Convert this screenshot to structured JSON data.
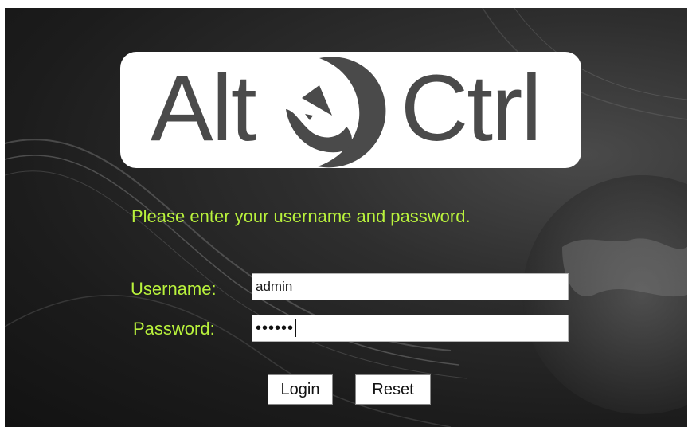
{
  "logo": {
    "left_text": "Alt",
    "right_text": "Ctrl"
  },
  "login": {
    "prompt": "Please enter your username and password.",
    "username_label": "Username:",
    "username_value": "admin",
    "password_label": "Password:",
    "password_masked": "••••••",
    "login_button": "Login",
    "reset_button": "Reset"
  },
  "colors": {
    "prompt_text": "#b9f23c",
    "logo_text": "#4a4a4a",
    "background": "#1c1c1c"
  }
}
